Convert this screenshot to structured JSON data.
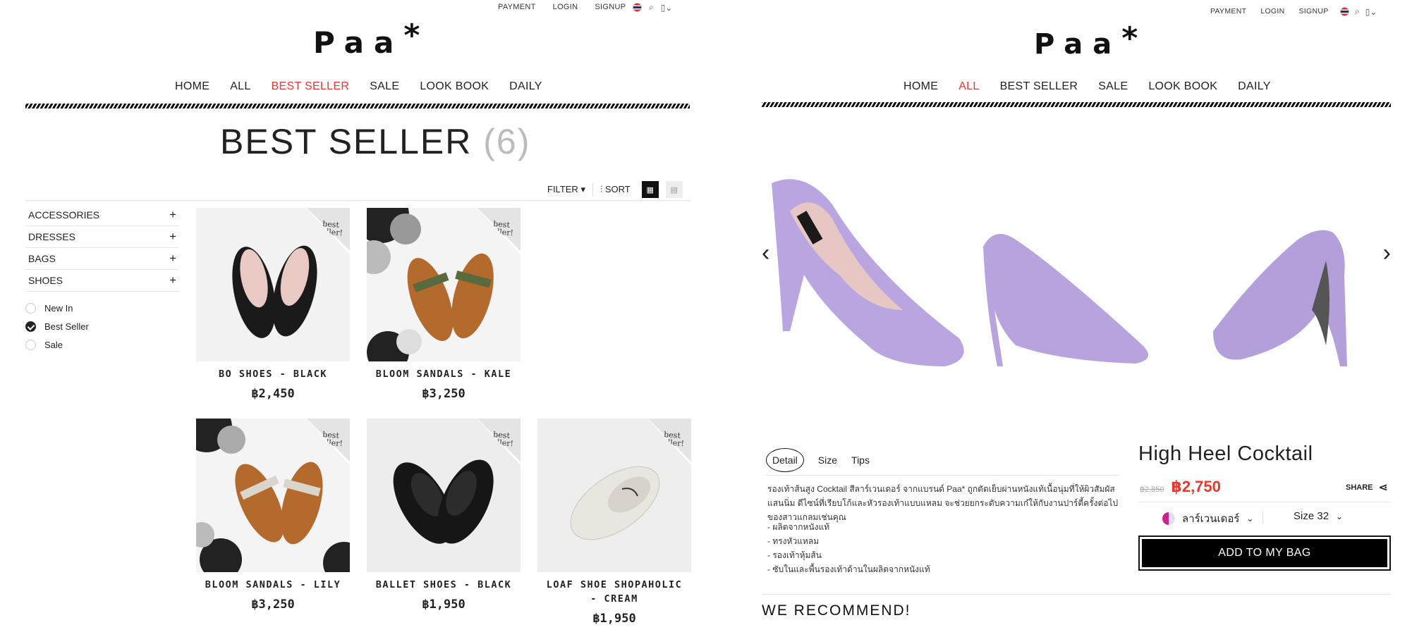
{
  "top_links": {
    "payment": "PAYMENT",
    "login": "LOGIN",
    "signup": "SIGNUP"
  },
  "logo": {
    "text": "Paa",
    "star": "*"
  },
  "left": {
    "nav": [
      "HOME",
      "ALL",
      "BEST SELLER",
      "SALE",
      "LOOK BOOK",
      "DAILY"
    ],
    "active_nav": "BEST SELLER",
    "page_title": "BEST SELLER",
    "page_count": "(6)",
    "toolbar": {
      "filter": "FILTER",
      "sort": "SORT"
    },
    "categories": [
      "ACCESSORIES",
      "DRESSES",
      "BAGS",
      "SHOES"
    ],
    "filters": [
      {
        "label": "New In",
        "checked": false
      },
      {
        "label": "Best Seller",
        "checked": true
      },
      {
        "label": "Sale",
        "checked": false
      }
    ],
    "tag_text": [
      "best",
      "seller!"
    ],
    "products": [
      {
        "name": "BO SHOES - BLACK",
        "price": "฿2,450"
      },
      {
        "name": "BLOOM SANDALS - KALE",
        "price": "฿3,250"
      },
      {
        "name": "BLOOM SANDALS - LILY",
        "price": "฿3,250"
      },
      {
        "name": "BALLET SHOES - BLACK",
        "price": "฿1,950"
      },
      {
        "name": "LOAF SHOE SHOPAHOLIC - CREAM",
        "price": "฿1,950"
      }
    ]
  },
  "right": {
    "nav": [
      "HOME",
      "ALL",
      "BEST SELLER",
      "SALE",
      "LOOK BOOK",
      "DAILY"
    ],
    "active_nav": "ALL",
    "tabs": [
      "Detail",
      "Size",
      "Tips"
    ],
    "description": "รองเท้าส้นสูง Cocktail สีลาร์เวนเดอร์ จากแบรนด์ Paa* ถูกตัดเย็บผ่านหนังแท้เนื้อนุ่มที่ให้ผิวสัมผัสแสนนิ่ม ดีไซน์ที่เรียบโก้และหัวรองเท้าแบบแหลม จะช่วยยกระดับความเก๋ให้กับงานปาร์ตี้ครั้งต่อไปของสาวแกลมเช่นคุณ",
    "bullets": [
      "- ผลิตจากหนังแท้",
      "- ทรงหัวแหลม",
      "- รองเท้าหุ้มส้น",
      "- ซับในและพื้นรองเท้าด้านในผลิตจากหนังแท้"
    ],
    "product_title": "High Heel Cocktail",
    "old_price": "฿2,850",
    "price": "฿2,750",
    "share": "SHARE",
    "color_label": "ลาร์เวนเดอร์",
    "size_label": "Size 32",
    "add_to_bag": "ADD TO MY BAG",
    "recommend": "WE RECOMMEND!"
  }
}
